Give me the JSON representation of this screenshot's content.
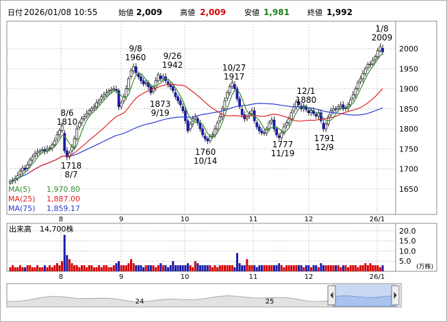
{
  "header": {
    "date_label": "日付",
    "date_value": "2026/01/08 10:55",
    "open_label": "始値",
    "open_value": "2,009",
    "high_label": "高値",
    "high_value": "2,009",
    "low_label": "安値",
    "low_value": "1,981",
    "close_label": "終値",
    "close_value": "1,992"
  },
  "colors": {
    "up": "#1a1aa8",
    "down": "#d40000",
    "ma5": "#2e8b2e",
    "ma25": "#e02020",
    "ma75": "#2a3ad0",
    "grid": "#c8c8c8",
    "high_text": "#d40000",
    "low_text": "#1a7a1a"
  },
  "chart_data": [
    {
      "type": "candlestick",
      "title": "",
      "ylim": [
        1600,
        2060
      ],
      "y_ticks": [
        2000,
        1950,
        1900,
        1850,
        1800,
        1750,
        1700,
        1650
      ],
      "x_ticks": [
        "8",
        "9",
        "10",
        "11",
        "12",
        "26/1"
      ],
      "ma_legend": [
        {
          "name": "MA(5)",
          "value": "1,970.80",
          "color": "#2e8b2e"
        },
        {
          "name": "MA(25)",
          "value": "1,887.00",
          "color": "#e02020"
        },
        {
          "name": "MA(75)",
          "value": "1,859.17",
          "color": "#2a3ad0"
        }
      ],
      "annotations": [
        {
          "date": "8/7",
          "value": "1718"
        },
        {
          "date": "8/6",
          "value": "1810"
        },
        {
          "date": "9/8",
          "value": "1960"
        },
        {
          "date": "9/19",
          "value": "1873"
        },
        {
          "date": "9/26",
          "value": "1942"
        },
        {
          "date": "10/14",
          "value": "1760"
        },
        {
          "date": "10/27",
          "value": "1917"
        },
        {
          "date": "11/19",
          "value": "1777"
        },
        {
          "date": "12/1",
          "value": "1880"
        },
        {
          "date": "12/9",
          "value": "1791"
        },
        {
          "date": "1/8",
          "value": "2009"
        }
      ],
      "close": [
        1668,
        1672,
        1676,
        1683,
        1695,
        1702,
        1698,
        1710,
        1722,
        1730,
        1738,
        1742,
        1745,
        1748,
        1744,
        1750,
        1752,
        1760,
        1770,
        1785,
        1796,
        1808,
        1745,
        1730,
        1740,
        1755,
        1775,
        1800,
        1815,
        1825,
        1830,
        1838,
        1845,
        1850,
        1855,
        1865,
        1870,
        1880,
        1885,
        1890,
        1895,
        1898,
        1900,
        1895,
        1855,
        1865,
        1880,
        1900,
        1925,
        1945,
        1955,
        1940,
        1930,
        1920,
        1912,
        1915,
        1905,
        1890,
        1902,
        1920,
        1935,
        1925,
        1930,
        1920,
        1910,
        1905,
        1895,
        1880,
        1870,
        1860,
        1845,
        1820,
        1795,
        1812,
        1825,
        1830,
        1815,
        1800,
        1785,
        1775,
        1770,
        1780,
        1785,
        1800,
        1815,
        1830,
        1850,
        1870,
        1890,
        1905,
        1915,
        1900,
        1875,
        1855,
        1835,
        1825,
        1830,
        1838,
        1845,
        1820,
        1805,
        1795,
        1790,
        1790,
        1800,
        1815,
        1822,
        1800,
        1785,
        1778,
        1790,
        1805,
        1815,
        1825,
        1840,
        1855,
        1868,
        1860,
        1850,
        1855,
        1848,
        1840,
        1845,
        1838,
        1832,
        1840,
        1820,
        1800,
        1812,
        1830,
        1845,
        1850,
        1848,
        1855,
        1860,
        1850,
        1852,
        1860,
        1872,
        1885,
        1900,
        1915,
        1925,
        1938,
        1950,
        1960,
        1962,
        1970,
        1980,
        1995,
        2005,
        1992
      ],
      "volume_chart": {
        "label": "出来高",
        "value": "14,700株",
        "unit": "(万株)",
        "ylim": [
          0,
          22
        ],
        "y_ticks": [
          "20.0",
          "15.0",
          "10.0",
          "5.0"
        ],
        "volumes": [
          2,
          3,
          2,
          2,
          3,
          2,
          2,
          3,
          3,
          2,
          2,
          3,
          2,
          2,
          3,
          2,
          3,
          2,
          3,
          4,
          3,
          5,
          18,
          8,
          6,
          4,
          3,
          3,
          2,
          3,
          3,
          2,
          3,
          3,
          2,
          2,
          3,
          2,
          3,
          3,
          2,
          2,
          3,
          4,
          5,
          3,
          3,
          3,
          4,
          6,
          4,
          3,
          3,
          3,
          2,
          3,
          3,
          3,
          3,
          2,
          3,
          4,
          3,
          3,
          2,
          3,
          5,
          3,
          3,
          3,
          3,
          3,
          4,
          3,
          2,
          5,
          4,
          3,
          3,
          3,
          3,
          3,
          2,
          3,
          2,
          3,
          3,
          3,
          3,
          3,
          3,
          2,
          9,
          4,
          3,
          3,
          6,
          3,
          3,
          3,
          2,
          3,
          3,
          3,
          3,
          3,
          3,
          3,
          3,
          4,
          3,
          2,
          3,
          3,
          3,
          3,
          3,
          3,
          3,
          2,
          3,
          3,
          2,
          3,
          3,
          2,
          4,
          3,
          3,
          3,
          3,
          3,
          3,
          3,
          2,
          3,
          3,
          2,
          3,
          3,
          3,
          2,
          3,
          3,
          4,
          3,
          4,
          3,
          3,
          3,
          2,
          3,
          3,
          2,
          3
        ]
      }
    }
  ],
  "navigator": {
    "labels": [
      "24",
      "25"
    ]
  }
}
